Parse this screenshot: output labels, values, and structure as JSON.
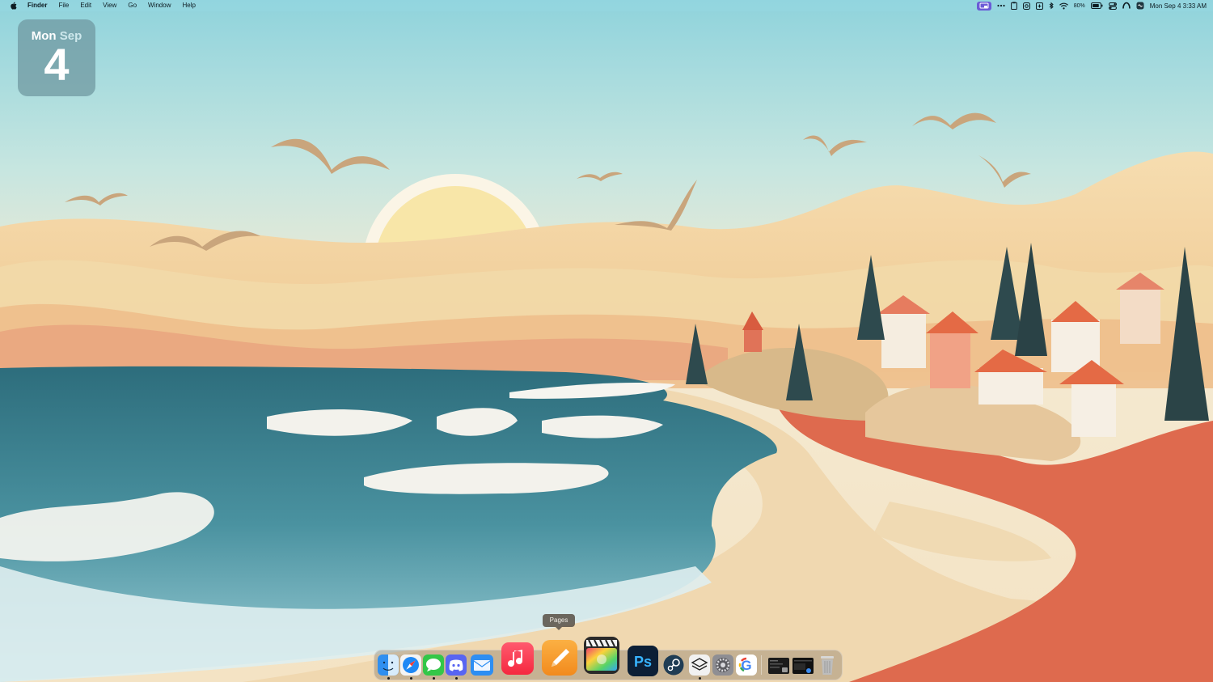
{
  "menubar": {
    "apple_icon": "apple-logo-icon",
    "app_name": "Finder",
    "items": [
      "File",
      "Edit",
      "View",
      "Go",
      "Window",
      "Help"
    ],
    "status": {
      "battery_percent": "80%",
      "clock": "Mon Sep 4  3:33 AM",
      "icons": [
        "screen-mirroring-icon",
        "more-icon",
        "clipboard-icon",
        "dropbox-icon",
        "time-machine-icon",
        "bluetooth-icon",
        "wifi-icon",
        "battery-icon",
        "control-center-icon",
        "user-icon",
        "siri-icon"
      ]
    }
  },
  "widget": {
    "weekday": "Mon",
    "month": "Sep",
    "day": "4"
  },
  "tooltip": {
    "text": "Pages"
  },
  "dock": {
    "apps": [
      {
        "name": "Finder",
        "icon": "finder-icon",
        "running": true
      },
      {
        "name": "Safari",
        "icon": "safari-icon",
        "running": true
      },
      {
        "name": "Messages",
        "icon": "messages-icon",
        "running": true
      },
      {
        "name": "Discord",
        "icon": "discord-icon",
        "running": true
      },
      {
        "name": "Mail",
        "icon": "mail-icon",
        "running": false
      },
      {
        "name": "Music",
        "icon": "music-icon",
        "running": false
      },
      {
        "name": "Pages",
        "icon": "pages-icon",
        "running": false
      },
      {
        "name": "Final Cut Pro",
        "icon": "final-cut-pro-icon",
        "running": false
      },
      {
        "name": "Photoshop",
        "icon": "photoshop-icon",
        "label": "Ps",
        "running": false
      },
      {
        "name": "Steam",
        "icon": "steam-icon",
        "running": false
      },
      {
        "name": "Layers",
        "icon": "layers-icon",
        "running": true
      },
      {
        "name": "Settings",
        "icon": "settings-icon",
        "running": false
      },
      {
        "name": "Google Chrome",
        "icon": "google-icon",
        "label": "G",
        "running": false
      },
      {
        "name": "Window 1",
        "icon": "minimized-window-icon",
        "running": false
      },
      {
        "name": "Window 2",
        "icon": "minimized-window-icon",
        "running": false
      },
      {
        "name": "Trash",
        "icon": "trash-icon",
        "running": false
      }
    ]
  },
  "colors": {
    "sky_top": "#8fd3dc",
    "sky_bottom": "#f4ead2",
    "sand": "#efd5ae",
    "ocean": "#2e7384",
    "rocks": "#dd6b4d",
    "pages_orange": "#f59b2b"
  }
}
